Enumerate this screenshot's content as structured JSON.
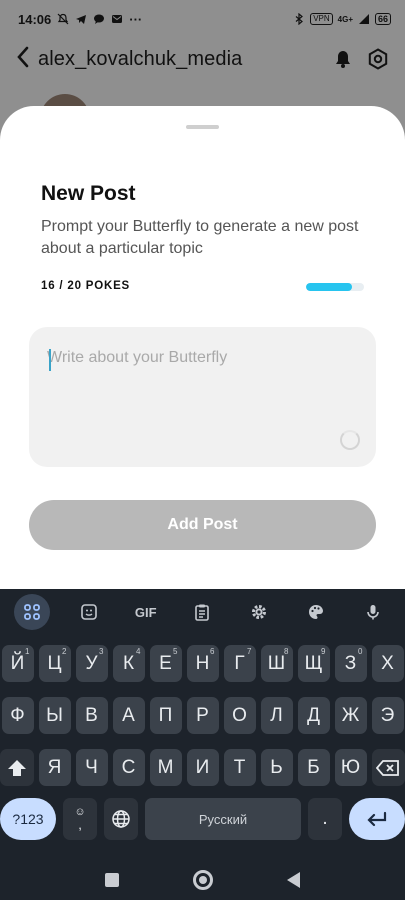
{
  "status_bar": {
    "time": "14:06",
    "left_icons": [
      "mute-icon",
      "telegram-icon",
      "chat-icon",
      "mail-icon"
    ],
    "more": "···",
    "vpn": "VPN",
    "network": "4G+",
    "battery": "66"
  },
  "app_header": {
    "back_glyph": "‹",
    "username": "alex_kovalchuk_media",
    "icons": [
      "bell-icon",
      "settings-icon"
    ]
  },
  "sheet": {
    "title": "New Post",
    "subtitle": "Prompt your Butterfly to generate a new post about a particular topic",
    "pokes_label": "16 / 20 POKES",
    "pokes_used": 16,
    "pokes_total": 20,
    "progress_fraction": 0.8,
    "input_placeholder": "Write about your Butterfly",
    "input_value": "",
    "add_button": "Add Post",
    "accent_color": "#27c4ef"
  },
  "keyboard": {
    "toolbar": [
      "apps-icon",
      "sticker-icon",
      "GIF",
      "clipboard-icon",
      "settings-icon",
      "palette-icon",
      "mic-icon"
    ],
    "row1": [
      {
        "k": "Й",
        "h": "1"
      },
      {
        "k": "Ц",
        "h": "2"
      },
      {
        "k": "У",
        "h": "3"
      },
      {
        "k": "К",
        "h": "4"
      },
      {
        "k": "Е",
        "h": "5"
      },
      {
        "k": "Н",
        "h": "6"
      },
      {
        "k": "Г",
        "h": "7"
      },
      {
        "k": "Ш",
        "h": "8"
      },
      {
        "k": "Щ",
        "h": "9"
      },
      {
        "k": "З",
        "h": "0"
      },
      {
        "k": "Х",
        "h": ""
      }
    ],
    "row2": [
      "Ф",
      "Ы",
      "В",
      "А",
      "П",
      "Р",
      "О",
      "Л",
      "Д",
      "Ж",
      "Э"
    ],
    "row3": [
      "Я",
      "Ч",
      "С",
      "М",
      "И",
      "Т",
      "Ь",
      "Б",
      "Ю"
    ],
    "sym_label": "?123",
    "comma": ",",
    "space_label": "Русский",
    "period": "."
  }
}
